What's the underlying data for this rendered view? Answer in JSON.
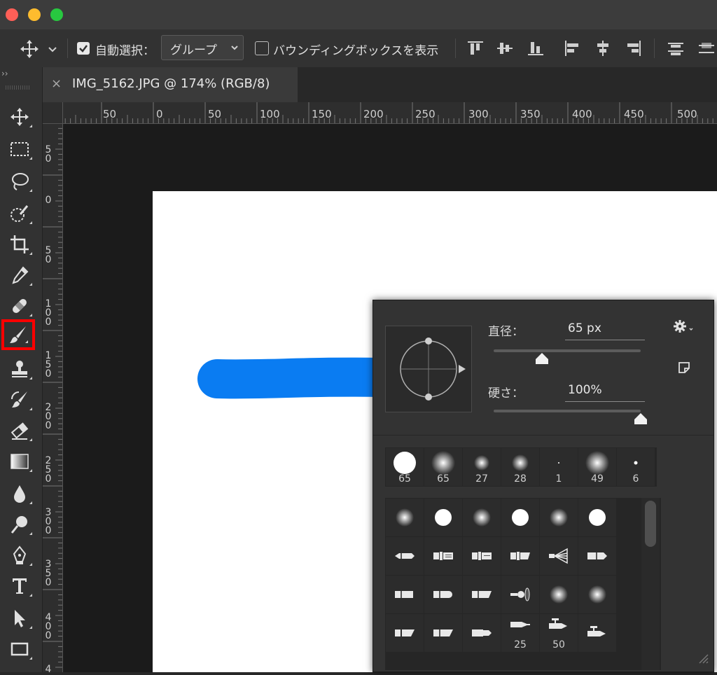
{
  "window": {
    "traffic_lights": {
      "close": "#fe5f57",
      "minimize": "#febc2e",
      "zoom": "#28c840"
    }
  },
  "options_bar": {
    "auto_select_label": "自動選択：",
    "auto_select_checked": true,
    "mode_value": "グループ",
    "show_bounding_box_label": "バウンディングボックスを表示",
    "show_bounding_box_checked": false
  },
  "document_tab": {
    "close_glyph": "×",
    "title": "IMG_5162.JPG @ 174% (RGB/8)"
  },
  "ruler": {
    "horizontal": [
      "50",
      "0",
      "50",
      "100",
      "150",
      "200",
      "250",
      "300",
      "350",
      "400",
      "450",
      "500"
    ],
    "vertical": [
      [
        "5",
        "0"
      ],
      [
        "0"
      ],
      [
        "5",
        "0"
      ],
      [
        "1",
        "0",
        "0"
      ],
      [
        "1",
        "5",
        "0"
      ],
      [
        "2",
        "0",
        "0"
      ],
      [
        "2",
        "5",
        "0"
      ],
      [
        "3",
        "0",
        "0"
      ],
      [
        "3",
        "5",
        "0"
      ],
      [
        "4",
        "0",
        "0"
      ],
      [
        "4"
      ]
    ]
  },
  "tools": {
    "selected": "brush-tool",
    "selected_highlight": "#ff0000"
  },
  "brush_color": "#0a7cf2",
  "brush_panel": {
    "diameter_label": "直径：",
    "diameter_value": "65 px",
    "diameter_level": 0.33,
    "hardness_label": "硬さ：",
    "hardness_value": "100%",
    "hardness_level": 1.0,
    "recent_brushes": [
      "65",
      "65",
      "27",
      "28",
      "1",
      "49",
      "6"
    ],
    "preset_numbers": [
      "25",
      "50"
    ]
  }
}
